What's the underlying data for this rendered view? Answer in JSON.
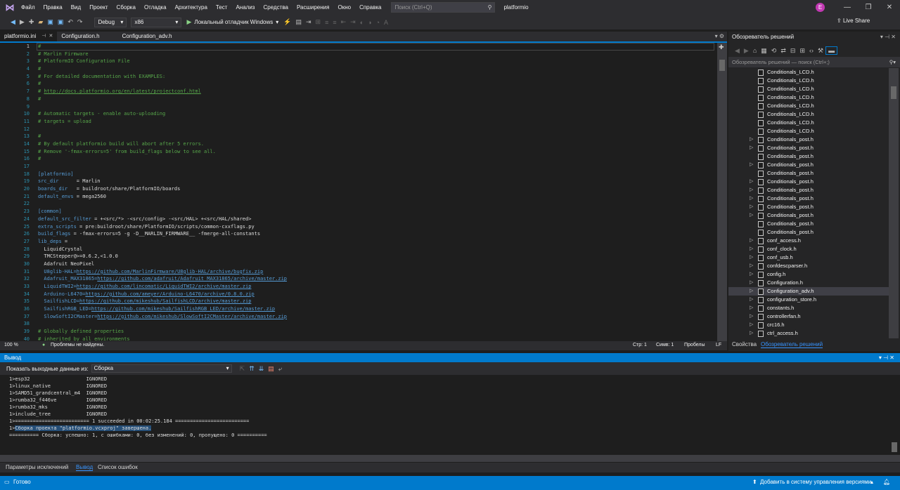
{
  "menu": {
    "items": [
      "Файл",
      "Правка",
      "Вид",
      "Проект",
      "Сборка",
      "Отладка",
      "Архитектура",
      "Тест",
      "Анализ",
      "Средства",
      "Расширения",
      "Окно",
      "Справка"
    ],
    "search_placeholder": "Поиск (Ctrl+Q)",
    "solution_name": "platformio",
    "avatar_initial": "E",
    "live_share": "Live Share"
  },
  "toolbar": {
    "config": "Debug",
    "platform": "x86",
    "run_label": "Локальный отладчик Windows"
  },
  "tabs": [
    {
      "label": "platformio.ini",
      "active": true
    },
    {
      "label": "Configuration.h",
      "active": false
    },
    {
      "label": "Configuration_adv.h",
      "active": false
    }
  ],
  "editor": {
    "lines": [
      [
        [
          "c-com",
          "#"
        ]
      ],
      [
        [
          "c-com",
          "# Marlin Firmware"
        ]
      ],
      [
        [
          "c-com",
          "# PlatformIO Configuration File"
        ]
      ],
      [
        [
          "c-com",
          "#"
        ]
      ],
      [
        [
          "c-com",
          "# For detailed documentation with EXAMPLES:"
        ]
      ],
      [
        [
          "c-com",
          "#"
        ]
      ],
      [
        [
          "c-com",
          "# "
        ],
        [
          "c-url",
          "http://docs.platformio.org/en/latest/projectconf.html"
        ]
      ],
      [
        [
          "c-com",
          "#"
        ]
      ],
      [],
      [
        [
          "c-com",
          "# Automatic targets - enable auto-uploading"
        ]
      ],
      [
        [
          "c-com",
          "# targets = upload"
        ]
      ],
      [],
      [
        [
          "c-com",
          "#"
        ]
      ],
      [
        [
          "c-com",
          "# By default platformio build will abort after 5 errors."
        ]
      ],
      [
        [
          "c-com",
          "# Remove '-fmax-errors=5' from build_flags below to see all."
        ]
      ],
      [
        [
          "c-com",
          "#"
        ]
      ],
      [],
      [
        [
          "c-sec",
          "[platformio]"
        ]
      ],
      [
        [
          "c-key",
          "src_dir"
        ],
        [
          "c-txt",
          "      = Marlin"
        ]
      ],
      [
        [
          "c-key",
          "boards_dir"
        ],
        [
          "c-txt",
          "   = buildroot/share/PlatformIO/boards"
        ]
      ],
      [
        [
          "c-key",
          "default_envs"
        ],
        [
          "c-txt",
          " = mega2560"
        ]
      ],
      [],
      [
        [
          "c-sec",
          "[common]"
        ]
      ],
      [
        [
          "c-key",
          "default_src_filter"
        ],
        [
          "c-txt",
          " = +<src/*> -<src/config> -<src/HAL> +<src/HAL/shared>"
        ]
      ],
      [
        [
          "c-key",
          "extra_scripts"
        ],
        [
          "c-txt",
          " = pre:buildroot/share/PlatformIO/scripts/common-cxxflags.py"
        ]
      ],
      [
        [
          "c-key",
          "build_flags"
        ],
        [
          "c-txt",
          " = -fmax-errors=5 -g -D__MARLIN_FIRMWARE__ -fmerge-all-constants"
        ]
      ],
      [
        [
          "c-key",
          "lib_deps"
        ],
        [
          "c-txt",
          " ="
        ]
      ],
      [
        [
          "c-txt",
          "  LiquidCrystal"
        ]
      ],
      [
        [
          "c-txt",
          "  TMCStepper@>=0.6.2,<1.0.0"
        ]
      ],
      [
        [
          "c-txt",
          "  Adafruit NeoPixel"
        ]
      ],
      [
        [
          "c-lnk",
          "  U8glib-HAL="
        ],
        [
          "c-lnku",
          "https://github.com/MarlinFirmware/U8glib-HAL/archive/bugfix.zip"
        ]
      ],
      [
        [
          "c-lnk",
          "  Adafruit_MAX31865="
        ],
        [
          "c-lnku",
          "https://github.com/adafruit/Adafruit_MAX31865/archive/master.zip"
        ]
      ],
      [
        [
          "c-lnk",
          "  LiquidTWI2="
        ],
        [
          "c-lnku",
          "https://github.com/lincomatic/LiquidTWI2/archive/master.zip"
        ]
      ],
      [
        [
          "c-lnk",
          "  Arduino-L6470="
        ],
        [
          "c-lnku",
          "https://github.com/ameyer/Arduino-L6470/archive/0.8.0.zip"
        ]
      ],
      [
        [
          "c-lnk",
          "  SailfishLCD="
        ],
        [
          "c-lnku",
          "https://github.com/mikeshub/SailfishLCD/archive/master.zip"
        ]
      ],
      [
        [
          "c-lnk",
          "  SailfishRGB_LED="
        ],
        [
          "c-lnku",
          "https://github.com/mikeshub/SailfishRGB_LED/archive/master.zip"
        ]
      ],
      [
        [
          "c-lnk",
          "  SlowSoftI2CMaster="
        ],
        [
          "c-lnku",
          "https://github.com/mikeshub/SlowSoftI2CMaster/archive/master.zip"
        ]
      ],
      [],
      [
        [
          "c-com",
          "# Globally defined properties"
        ]
      ],
      [
        [
          "c-com",
          "# inherited by all environments"
        ]
      ]
    ],
    "zoom": "100 %",
    "problems": "Проблемы не найдены.",
    "line_info": "Стр: 1",
    "col_info": "Симв: 1",
    "ws_info": "Пробелы",
    "eol_info": "LF"
  },
  "solution_explorer": {
    "title": "Обозреватель решений",
    "search_placeholder": "Обозреватель решений — поиск (Ctrl+;)",
    "items": [
      {
        "name": "Conditionals_LCD.h",
        "arrow": false,
        "selected": false
      },
      {
        "name": "Conditionals_LCD.h",
        "arrow": false,
        "selected": false
      },
      {
        "name": "Conditionals_LCD.h",
        "arrow": false,
        "selected": false
      },
      {
        "name": "Conditionals_LCD.h",
        "arrow": false,
        "selected": false
      },
      {
        "name": "Conditionals_LCD.h",
        "arrow": false,
        "selected": false
      },
      {
        "name": "Conditionals_LCD.h",
        "arrow": false,
        "selected": false
      },
      {
        "name": "Conditionals_LCD.h",
        "arrow": false,
        "selected": false
      },
      {
        "name": "Conditionals_LCD.h",
        "arrow": false,
        "selected": false
      },
      {
        "name": "Conditionals_post.h",
        "arrow": true,
        "selected": false
      },
      {
        "name": "Conditionals_post.h",
        "arrow": true,
        "selected": false
      },
      {
        "name": "Conditionals_post.h",
        "arrow": false,
        "selected": false
      },
      {
        "name": "Conditionals_post.h",
        "arrow": true,
        "selected": false
      },
      {
        "name": "Conditionals_post.h",
        "arrow": false,
        "selected": false
      },
      {
        "name": "Conditionals_post.h",
        "arrow": true,
        "selected": false
      },
      {
        "name": "Conditionals_post.h",
        "arrow": true,
        "selected": false
      },
      {
        "name": "Conditionals_post.h",
        "arrow": true,
        "selected": false
      },
      {
        "name": "Conditionals_post.h",
        "arrow": true,
        "selected": false
      },
      {
        "name": "Conditionals_post.h",
        "arrow": true,
        "selected": false
      },
      {
        "name": "Conditionals_post.h",
        "arrow": false,
        "selected": false
      },
      {
        "name": "Conditionals_post.h",
        "arrow": false,
        "selected": false
      },
      {
        "name": "conf_access.h",
        "arrow": true,
        "selected": false
      },
      {
        "name": "conf_clock.h",
        "arrow": true,
        "selected": false
      },
      {
        "name": "conf_usb.h",
        "arrow": true,
        "selected": false
      },
      {
        "name": "confdescparser.h",
        "arrow": true,
        "selected": false
      },
      {
        "name": "config.h",
        "arrow": true,
        "selected": false
      },
      {
        "name": "Configuration.h",
        "arrow": true,
        "selected": false
      },
      {
        "name": "Configuration_adv.h",
        "arrow": true,
        "selected": true
      },
      {
        "name": "configuration_store.h",
        "arrow": true,
        "selected": false
      },
      {
        "name": "constants.h",
        "arrow": true,
        "selected": false
      },
      {
        "name": "controllerfan.h",
        "arrow": true,
        "selected": false
      },
      {
        "name": "crc16.h",
        "arrow": true,
        "selected": false
      },
      {
        "name": "ctrl_access.h",
        "arrow": true,
        "selected": false
      }
    ],
    "tab_properties": "Свойства",
    "tab_explorer": "Обозреватель решений"
  },
  "output": {
    "title": "Вывод",
    "show_label": "Показать выходные данные из:",
    "source": "Сборка",
    "lines": [
      "1>esp32                   IGNORED",
      "1>linux_native            IGNORED",
      "1>SAMD51_grandcentral_m4  IGNORED",
      "1>rumba32_f446ve          IGNORED",
      "1>rumba32_mks             IGNORED",
      "1>include_tree            IGNORED",
      "1>========================= 1 succeeded in 00:02:25.184 ========================="
    ],
    "highlight_prefix": "1>",
    "highlight_text": "Сборка проекта \"platformio.vcxproj\" завершена.",
    "summary": "========== Сборка: успешно: 1, с ошибками: 0, без изменений: 0, пропущено: 0 =========="
  },
  "bottom_tabs": [
    "Параметры исключений",
    "Вывод",
    "Список ошибок"
  ],
  "status": {
    "ready": "Готово",
    "vcs": "Добавить в систему управления версиями"
  }
}
